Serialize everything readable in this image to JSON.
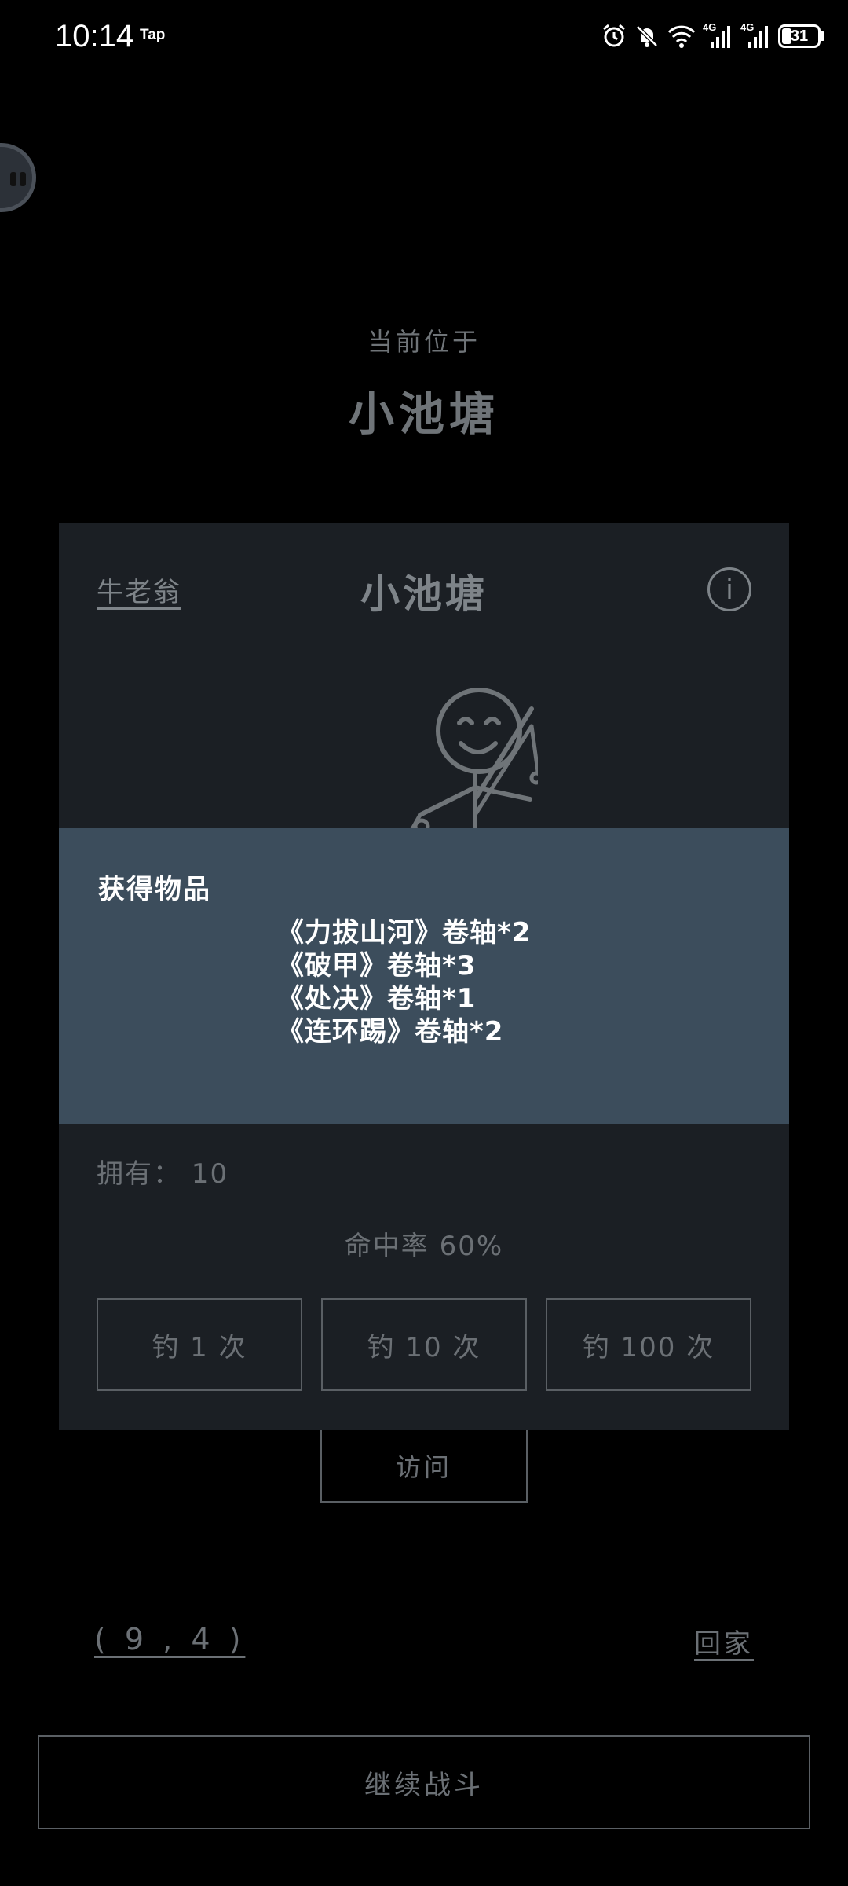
{
  "status_bar": {
    "time": "10:14",
    "tap_label": "Tap",
    "battery": "31",
    "network_1": "4G",
    "network_2": "4G"
  },
  "location": {
    "caption": "当前位于",
    "name": "小池塘"
  },
  "card": {
    "owner": "牛老翁",
    "title": "小池塘",
    "info_symbol": "i",
    "owned": "拥有：  10",
    "hit_rate": "命中率 60%",
    "buttons": [
      {
        "label": "钓 1 次"
      },
      {
        "label": "钓 10 次"
      },
      {
        "label": "钓 100 次"
      }
    ]
  },
  "modal": {
    "title": "获得物品",
    "items": [
      "《力拔山河》卷轴*2",
      "《破甲》卷轴*3",
      "《处决》卷轴*1",
      "《连环踢》卷轴*2"
    ]
  },
  "visit_button": "访问",
  "coordinates": "( 9 , 4 )",
  "home_link": "回家",
  "continue_button": "继续战斗",
  "colors": {
    "background": "#000000",
    "card": "#1b1f24",
    "modal": "#3c4d5c",
    "muted_text": "#6b7075"
  }
}
